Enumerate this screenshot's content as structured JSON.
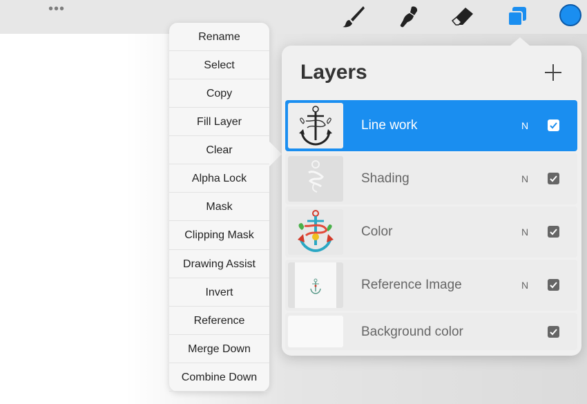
{
  "toolbar": {
    "more_icon": "ellipsis-icon",
    "tools": [
      "brush-icon",
      "smudge-icon",
      "eraser-icon",
      "layers-icon"
    ],
    "current_color": "#1a8ef0"
  },
  "context_menu": {
    "items": [
      "Rename",
      "Select",
      "Copy",
      "Fill Layer",
      "Clear",
      "Alpha Lock",
      "Mask",
      "Clipping Mask",
      "Drawing Assist",
      "Invert",
      "Reference",
      "Merge Down",
      "Combine Down"
    ]
  },
  "layers_panel": {
    "title": "Layers",
    "add_icon": "plus-icon",
    "layers": [
      {
        "name": "Line work",
        "blend": "N",
        "visible": true,
        "selected": true
      },
      {
        "name": "Shading",
        "blend": "N",
        "visible": true,
        "selected": false
      },
      {
        "name": "Color",
        "blend": "N",
        "visible": true,
        "selected": false
      },
      {
        "name": "Reference Image",
        "blend": "N",
        "visible": true,
        "selected": false
      },
      {
        "name": "Background color",
        "blend": "",
        "visible": true,
        "selected": false
      }
    ]
  },
  "colors": {
    "accent": "#1a8ef0",
    "selected_layer": "#1a8ef0"
  }
}
